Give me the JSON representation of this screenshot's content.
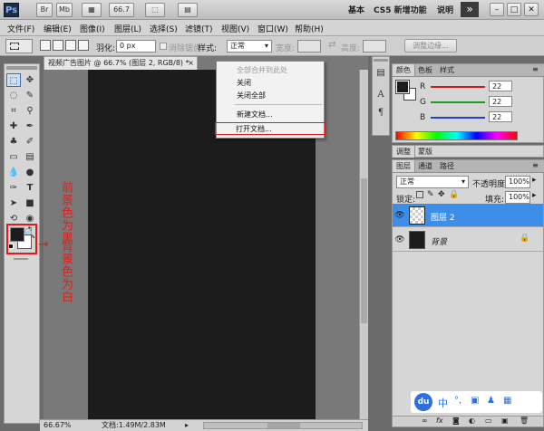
{
  "appbar": {
    "logo": "Ps",
    "buttons": [
      "Br",
      "Mb",
      "▦",
      "66.7",
      "⬚",
      "▤"
    ],
    "workspaces": [
      "基本",
      "CS5 新增功能",
      "说明"
    ],
    "more": "»"
  },
  "menubar": {
    "items": [
      "文件(F)",
      "编辑(E)",
      "图像(I)",
      "图层(L)",
      "选择(S)",
      "滤镜(T)",
      "视图(V)",
      "窗口(W)",
      "帮助(H)"
    ]
  },
  "options": {
    "feather_label": "羽化:",
    "feather_value": "0 px",
    "antialias_label": "消除锯齿",
    "style_label": "样式:",
    "style_value": "正常",
    "width_label": "宽度:",
    "height_label": "高度:",
    "refine_edge": "调整边缘..."
  },
  "document": {
    "tab_title": "视频广告图片 @ 66.7% (图层 2, RGB/8) *",
    "zoom": "66.67%",
    "doc_info": "文档:1.49M/2.83M"
  },
  "dropdown": {
    "items": [
      {
        "label": "全部合并到此处",
        "disabled": true
      },
      {
        "label": "关闭",
        "disabled": false
      },
      {
        "label": "关闭全部",
        "disabled": false
      },
      {
        "label": "新建文档...",
        "disabled": false
      },
      {
        "label": "打开文档...",
        "disabled": false
      }
    ]
  },
  "annotation": {
    "foreground": "前景色为黑",
    "background": "背景色为白",
    "arrow": "→"
  },
  "color_panel": {
    "tabs": [
      "颜色",
      "色板",
      "样式"
    ],
    "r_label": "R",
    "r_value": "22",
    "g_label": "G",
    "g_value": "22",
    "b_label": "B",
    "b_value": "22"
  },
  "adjust_panel": {
    "tabs": [
      "调整",
      "蒙版"
    ]
  },
  "layers_panel": {
    "tabs": [
      "图层",
      "通道",
      "路径"
    ],
    "blend_mode": "正常",
    "opacity_label": "不透明度:",
    "opacity_value": "100%",
    "lock_label": "锁定:",
    "fill_label": "填充:",
    "fill_value": "100%",
    "layers": [
      {
        "name": "图层 2",
        "selected": true
      },
      {
        "name": "背景",
        "selected": false
      }
    ]
  },
  "watermark": {
    "du": "du",
    "zh": "中"
  },
  "colors": {
    "accent": "#3d8ee8",
    "highlight_red": "#e21b1b",
    "canvas": "#1c1c1c"
  }
}
